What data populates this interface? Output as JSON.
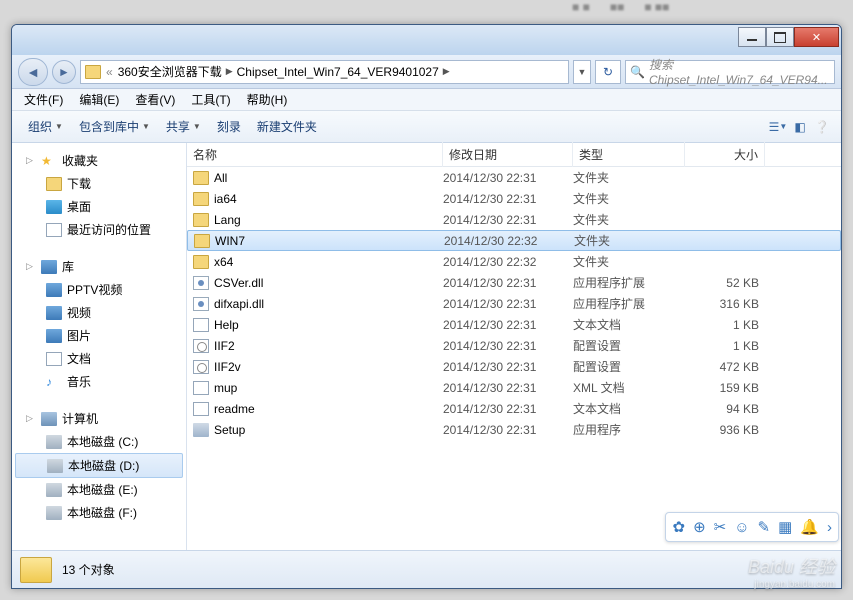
{
  "breadcrumb": {
    "prefix": "«",
    "part1": "360安全浏览器下载",
    "part2": "Chipset_Intel_Win7_64_VER9401027"
  },
  "search": {
    "placeholder": "搜索 Chipset_Intel_Win7_64_VER94..."
  },
  "menu": {
    "file": "文件(F)",
    "edit": "编辑(E)",
    "view": "查看(V)",
    "tools": "工具(T)",
    "help": "帮助(H)"
  },
  "toolbar": {
    "org": "组织",
    "include": "包含到库中",
    "share": "共享",
    "burn": "刻录",
    "newfolder": "新建文件夹"
  },
  "sidebar": {
    "fav": {
      "label": "收藏夹",
      "items": [
        {
          "icon": "download",
          "label": "下载"
        },
        {
          "icon": "desktop",
          "label": "桌面"
        },
        {
          "icon": "recent",
          "label": "最近访问的位置"
        }
      ]
    },
    "lib": {
      "label": "库",
      "items": [
        {
          "label": "PPTV视频"
        },
        {
          "label": "视频"
        },
        {
          "label": "图片"
        },
        {
          "label": "文档"
        },
        {
          "label": "音乐"
        }
      ]
    },
    "comp": {
      "label": "计算机",
      "items": [
        {
          "label": "本地磁盘 (C:)"
        },
        {
          "label": "本地磁盘 (D:)",
          "sel": true
        },
        {
          "label": "本地磁盘 (E:)"
        },
        {
          "label": "本地磁盘 (F:)"
        }
      ]
    }
  },
  "columns": {
    "name": "名称",
    "date": "修改日期",
    "type": "类型",
    "size": "大小"
  },
  "files": [
    {
      "icon": "fold",
      "name": "All",
      "date": "2014/12/30 22:31",
      "type": "文件夹",
      "size": ""
    },
    {
      "icon": "fold",
      "name": "ia64",
      "date": "2014/12/30 22:31",
      "type": "文件夹",
      "size": ""
    },
    {
      "icon": "fold",
      "name": "Lang",
      "date": "2014/12/30 22:31",
      "type": "文件夹",
      "size": ""
    },
    {
      "icon": "fold",
      "name": "WIN7",
      "date": "2014/12/30 22:32",
      "type": "文件夹",
      "size": "",
      "sel": true
    },
    {
      "icon": "fold",
      "name": "x64",
      "date": "2014/12/30 22:32",
      "type": "文件夹",
      "size": ""
    },
    {
      "icon": "dll",
      "name": "CSVer.dll",
      "date": "2014/12/30 22:31",
      "type": "应用程序扩展",
      "size": "52 KB"
    },
    {
      "icon": "dll",
      "name": "difxapi.dll",
      "date": "2014/12/30 22:31",
      "type": "应用程序扩展",
      "size": "316 KB"
    },
    {
      "icon": "txt",
      "name": "Help",
      "date": "2014/12/30 22:31",
      "type": "文本文档",
      "size": "1 KB"
    },
    {
      "icon": "ini",
      "name": "IIF2",
      "date": "2014/12/30 22:31",
      "type": "配置设置",
      "size": "1 KB"
    },
    {
      "icon": "ini",
      "name": "IIF2v",
      "date": "2014/12/30 22:31",
      "type": "配置设置",
      "size": "472 KB"
    },
    {
      "icon": "xml",
      "name": "mup",
      "date": "2014/12/30 22:31",
      "type": "XML 文档",
      "size": "159 KB"
    },
    {
      "icon": "txt",
      "name": "readme",
      "date": "2014/12/30 22:31",
      "type": "文本文档",
      "size": "94 KB"
    },
    {
      "icon": "exe",
      "name": "Setup",
      "date": "2014/12/30 22:31",
      "type": "应用程序",
      "size": "936 KB"
    }
  ],
  "status": {
    "count": "13 个对象"
  },
  "watermark": {
    "brand": "Baidu 经验",
    "url": "jingyan.baidu.com"
  }
}
